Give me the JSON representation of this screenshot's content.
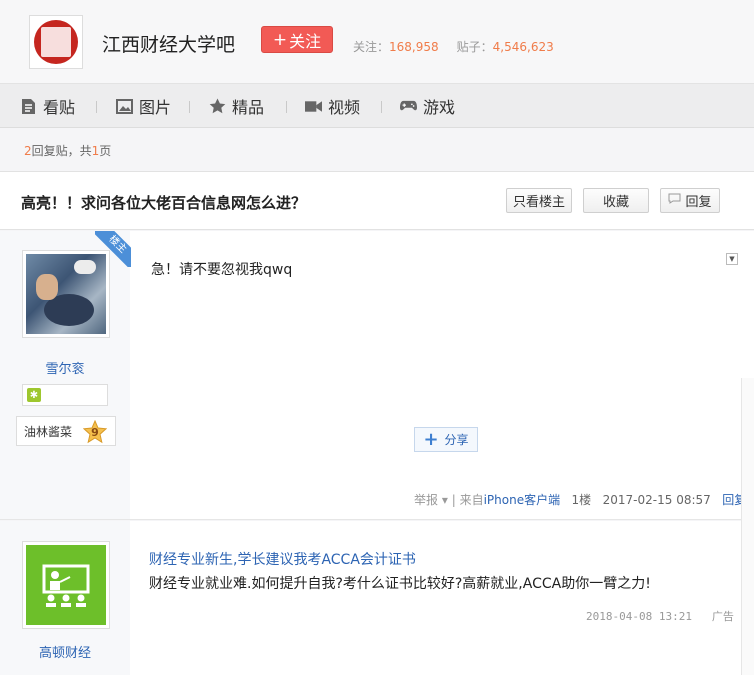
{
  "forum": {
    "name": "江西财经大学吧",
    "follow_label": "关注",
    "stats": {
      "followers_label": "关注：",
      "followers_value": "168,958",
      "posts_label": "贴子：",
      "posts_value": "4,546,623"
    }
  },
  "nav": {
    "items": [
      {
        "label": "看贴",
        "icon": "document-icon"
      },
      {
        "label": "图片",
        "icon": "image-icon"
      },
      {
        "label": "精品",
        "icon": "star-icon"
      },
      {
        "label": "视频",
        "icon": "video-camera-icon"
      },
      {
        "label": "游戏",
        "icon": "gamepad-icon"
      }
    ]
  },
  "reply_count": {
    "count": "2",
    "count_suffix": "回复贴，共",
    "pages": "1",
    "pages_suffix": "页"
  },
  "thread": {
    "title": "高亮！！求问各位大佬百合信息网怎么进？",
    "buttons": {
      "only_op": "只看楼主",
      "collect": "收藏",
      "reply": "回复"
    }
  },
  "posts": [
    {
      "badge": "楼主",
      "username": "雪尔衮",
      "level_name": "油林酱菜",
      "level_num": "9",
      "content": "急！请不要忽视我qwq",
      "share_label": "分享",
      "report_label": "举报",
      "source_prefix": "来自",
      "source_link": "iPhone客户端",
      "floor": "1楼",
      "time": "2017-02-15 08:57",
      "reply_label": "回复"
    }
  ],
  "ad": {
    "name": "高顿财经",
    "title": "财经专业新生,学长建议我考ACCA会计证书",
    "description": "财经专业就业难.如何提升自我?考什么证书比较好?高薪就业,ACCA助你一臂之力!",
    "time": "2018-04-08 13:21",
    "tag": "广告"
  },
  "colors": {
    "follow_button": "#f25a55",
    "stat_number": "#f07c4a",
    "link": "#2d64b3",
    "badge": "#4c8fd8",
    "ad_avatar": "#6dbf2a"
  }
}
